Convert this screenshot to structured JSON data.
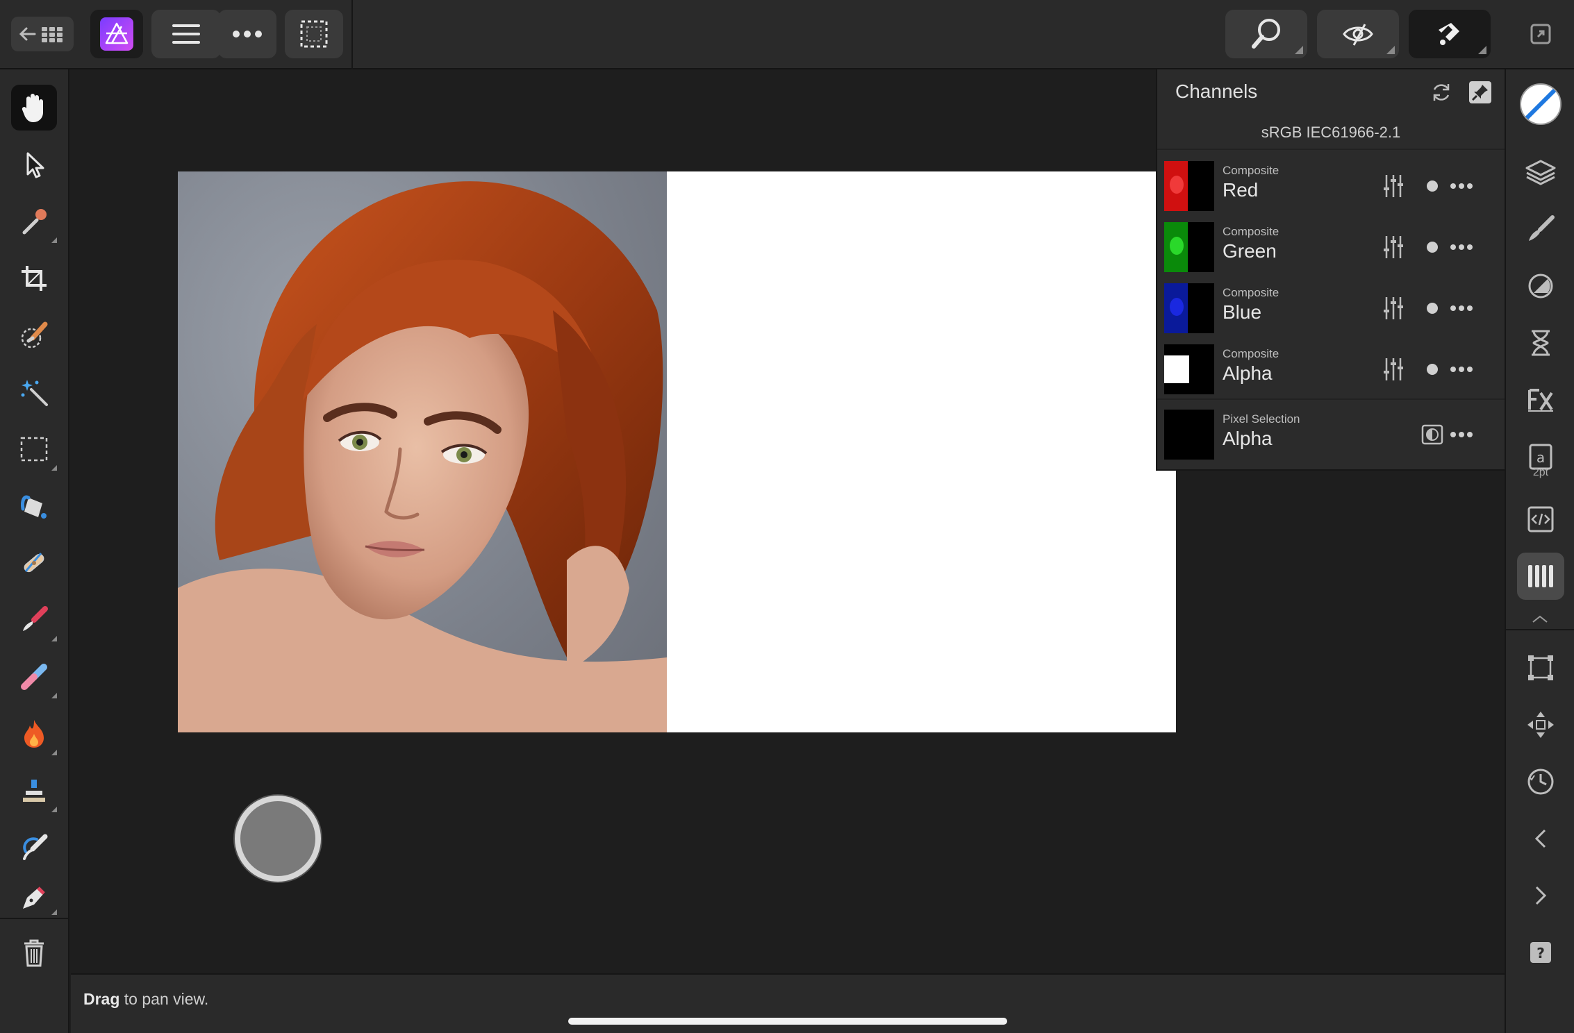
{
  "app": {
    "name": "Affinity Photo",
    "accent": "#9b3cf0"
  },
  "topbar": {
    "back_grid_icon": "back-to-gallery-icon",
    "persona_icon": "affinity-photo-icon",
    "menu_icon": "hamburger-menu-icon",
    "more_icon": "more-icon",
    "selection_icon": "selection-marquee-icon",
    "right_tools": [
      "zoom-icon",
      "view-icon",
      "snapping-icon",
      "fullscreen-icon"
    ]
  },
  "left_tools": [
    {
      "name": "hand-tool",
      "icon": "hand-icon",
      "active": true
    },
    {
      "name": "move-tool",
      "icon": "pointer-icon"
    },
    {
      "name": "color-picker-tool",
      "icon": "eyedropper-icon"
    },
    {
      "name": "crop-tool",
      "icon": "crop-icon"
    },
    {
      "name": "selection-brush-tool",
      "icon": "selection-brush-icon"
    },
    {
      "name": "flood-select-tool",
      "icon": "magic-wand-icon"
    },
    {
      "name": "marquee-tool",
      "icon": "marquee-icon"
    },
    {
      "name": "flood-fill-tool",
      "icon": "paint-bucket-icon"
    },
    {
      "name": "inpainting-tool",
      "icon": "bandage-icon"
    },
    {
      "name": "paint-brush-tool",
      "icon": "paint-brush-icon"
    },
    {
      "name": "erase-brush-tool",
      "icon": "eraser-icon"
    },
    {
      "name": "burn-brush-tool",
      "icon": "flame-icon"
    },
    {
      "name": "clone-tool",
      "icon": "stamp-icon"
    },
    {
      "name": "smudge-tool",
      "icon": "smudge-icon"
    },
    {
      "name": "pen-tool",
      "icon": "pen-icon"
    },
    {
      "name": "delete-button",
      "icon": "trash-icon"
    }
  ],
  "status": {
    "bold": "Drag",
    "text": " to pan view."
  },
  "channels_panel": {
    "title": "Channels",
    "profile": "sRGB IEC61966-2.1",
    "rows": [
      {
        "sub": "Composite",
        "name": "Red",
        "tint": "#ff1a1a"
      },
      {
        "sub": "Composite",
        "name": "Green",
        "tint": "#1adc1a"
      },
      {
        "sub": "Composite",
        "name": "Blue",
        "tint": "#1a2aff"
      },
      {
        "sub": "Composite",
        "name": "Alpha",
        "tint": "#ffffff"
      }
    ],
    "pixel_selection": {
      "sub": "Pixel Selection",
      "name": "Alpha"
    }
  },
  "right_tools": {
    "stroke_width_label": "2pt"
  }
}
